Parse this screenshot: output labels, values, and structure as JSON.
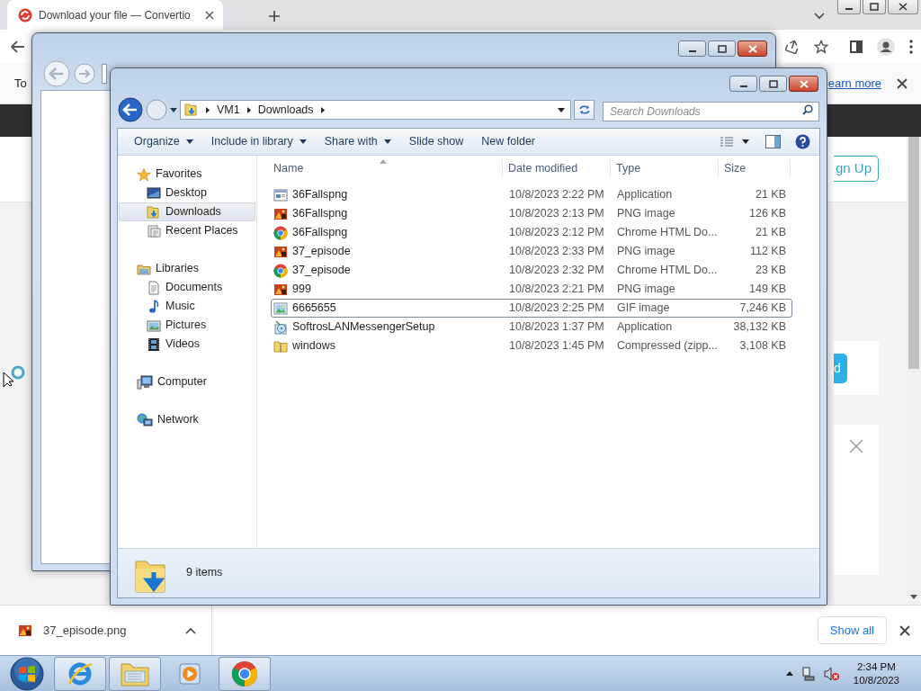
{
  "browser": {
    "tab": {
      "title": "Download your file — Convertio"
    },
    "infobar": {
      "text": "To",
      "link": "earn more"
    },
    "signup_button": "gn Up",
    "action_button": "d",
    "download_shelf": {
      "file": "37_episode.png",
      "show_all": "Show all"
    }
  },
  "explorer": {
    "breadcrumb": [
      "VM1",
      "Downloads"
    ],
    "search": {
      "placeholder": "Search Downloads"
    },
    "commands": [
      {
        "label": "Organize",
        "dropdown": true
      },
      {
        "label": "Include in library",
        "dropdown": true
      },
      {
        "label": "Share with",
        "dropdown": true
      },
      {
        "label": "Slide show",
        "dropdown": false
      },
      {
        "label": "New folder",
        "dropdown": false
      }
    ],
    "nav": [
      {
        "label": "Favorites",
        "kind": "star",
        "selected": false,
        "children": [
          {
            "label": "Desktop",
            "kind": "desktop",
            "selected": false
          },
          {
            "label": "Downloads",
            "kind": "downloads",
            "selected": true
          },
          {
            "label": "Recent Places",
            "kind": "recent",
            "selected": false
          }
        ]
      },
      {
        "label": "Libraries",
        "kind": "library",
        "selected": false,
        "children": [
          {
            "label": "Documents",
            "kind": "documents",
            "selected": false
          },
          {
            "label": "Music",
            "kind": "music",
            "selected": false
          },
          {
            "label": "Pictures",
            "kind": "pictures",
            "selected": false
          },
          {
            "label": "Videos",
            "kind": "videos",
            "selected": false
          }
        ]
      },
      {
        "label": "Computer",
        "kind": "computer",
        "selected": false
      },
      {
        "label": "Network",
        "kind": "network",
        "selected": false
      }
    ],
    "columns": [
      {
        "label": "Name",
        "sorted": true
      },
      {
        "label": "Date modified",
        "sorted": false
      },
      {
        "label": "Type",
        "sorted": false
      },
      {
        "label": "Size",
        "sorted": false
      }
    ],
    "files": [
      {
        "name": "36Fallspng",
        "date": "10/8/2023 2:22 PM",
        "type": "Application",
        "size": "21 KB",
        "kind": "app",
        "focused": false
      },
      {
        "name": "36Fallspng",
        "date": "10/8/2023 2:13 PM",
        "type": "PNG image",
        "size": "126 KB",
        "kind": "png",
        "focused": false
      },
      {
        "name": "36Fallspng",
        "date": "10/8/2023 2:12 PM",
        "type": "Chrome HTML Do...",
        "size": "21 KB",
        "kind": "chrome",
        "focused": false
      },
      {
        "name": "37_episode",
        "date": "10/8/2023 2:33 PM",
        "type": "PNG image",
        "size": "112 KB",
        "kind": "png",
        "focused": false
      },
      {
        "name": "37_episode",
        "date": "10/8/2023 2:32 PM",
        "type": "Chrome HTML Do...",
        "size": "23 KB",
        "kind": "chrome",
        "focused": false
      },
      {
        "name": "999",
        "date": "10/8/2023 2:21 PM",
        "type": "PNG image",
        "size": "149 KB",
        "kind": "png",
        "focused": false
      },
      {
        "name": "6665655",
        "date": "10/8/2023 2:25 PM",
        "type": "GIF image",
        "size": "7,246 KB",
        "kind": "gif",
        "focused": true
      },
      {
        "name": "SoftrosLANMessengerSetup",
        "date": "10/8/2023 1:37 PM",
        "type": "Application",
        "size": "38,132 KB",
        "kind": "setup",
        "focused": false
      },
      {
        "name": "windows",
        "date": "10/8/2023 1:45 PM",
        "type": "Compressed (zipp...",
        "size": "3,108 KB",
        "kind": "zip",
        "focused": false
      }
    ],
    "status": "9 items"
  },
  "taskbar": {
    "apps": [
      {
        "kind": "ie",
        "running": true
      },
      {
        "kind": "explorer",
        "running": true
      },
      {
        "kind": "media",
        "running": false
      },
      {
        "kind": "chrome",
        "running": true
      }
    ],
    "clock": {
      "time": "2:34 PM",
      "date": "10/8/2023"
    }
  }
}
